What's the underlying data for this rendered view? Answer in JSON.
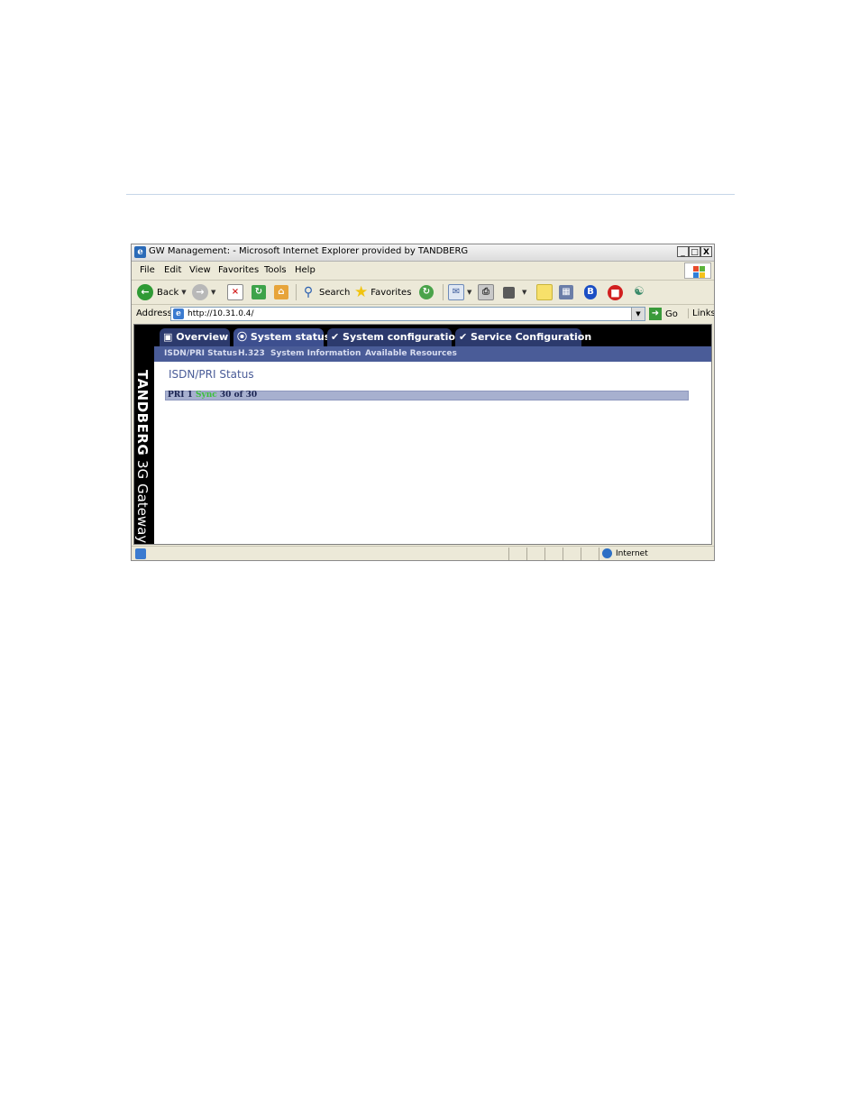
{
  "window": {
    "title": "GW Management: - Microsoft Internet Explorer provided by TANDBERG",
    "minimize": "_",
    "maximize": "□",
    "close": "X"
  },
  "menu": [
    "File",
    "Edit",
    "View",
    "Favorites",
    "Tools",
    "Help"
  ],
  "toolbar": {
    "back_label": "Back",
    "search_label": "Search",
    "favorites_label": "Favorites"
  },
  "address": {
    "label": "Address",
    "url": "http://10.31.0.4/",
    "go_label": "Go",
    "links_label": "Links"
  },
  "app": {
    "brand_name": "TANDBERG",
    "brand_product": "3G Gateway",
    "tabs": [
      "Overview",
      "System status",
      "System configuration",
      "Service Configuration"
    ],
    "active_tab": "System status",
    "subnav": [
      "ISDN/PRI Status",
      "H.323",
      "System Information",
      "Available Resources"
    ],
    "page_title": "ISDN/PRI Status",
    "status_row": {
      "prefix": "PRI 1",
      "state": "Sync",
      "suffix": "30 of 30"
    }
  },
  "statusbar": {
    "zone": "Internet"
  },
  "colors": {
    "tab_bg": "#2c3a6d",
    "subnav_bg": "#4a5c98",
    "status_row_bg": "#a7b0cf",
    "sync_green": "#3bbf3b"
  }
}
